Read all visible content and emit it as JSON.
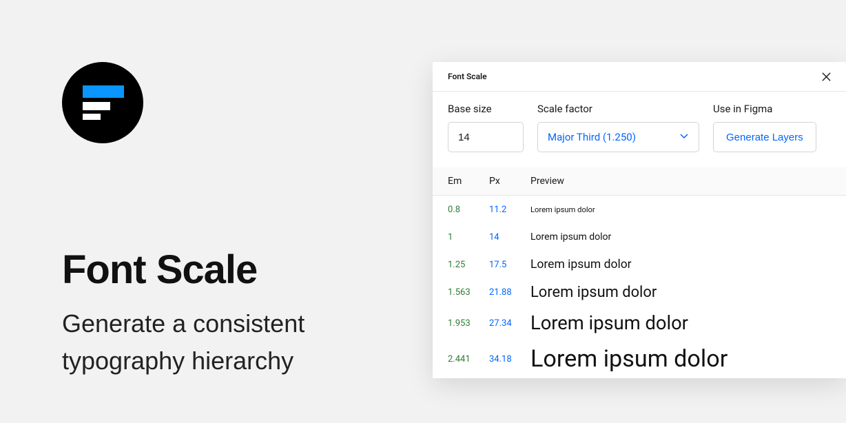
{
  "hero": {
    "title": "Font Scale",
    "subtitle": "Generate a consistent typography hierarchy"
  },
  "plugin": {
    "title": "Font Scale",
    "controls": {
      "base_label": "Base size",
      "base_value": "14",
      "scale_label": "Scale factor",
      "scale_value": "Major Third (1.250)",
      "figma_label": "Use in Figma",
      "generate_label": "Generate Layers"
    },
    "table": {
      "headers": {
        "em": "Em",
        "px": "Px",
        "preview": "Preview"
      },
      "rows": [
        {
          "em": "0.8",
          "px": "11.2",
          "preview": "Lorem ipsum dolor",
          "size": 11.2
        },
        {
          "em": "1",
          "px": "14",
          "preview": "Lorem ipsum dolor",
          "size": 14
        },
        {
          "em": "1.25",
          "px": "17.5",
          "preview": "Lorem ipsum dolor",
          "size": 17.5
        },
        {
          "em": "1.563",
          "px": "21.88",
          "preview": "Lorem ipsum dolor",
          "size": 21.88
        },
        {
          "em": "1.953",
          "px": "27.34",
          "preview": "Lorem ipsum dolor",
          "size": 27.34
        },
        {
          "em": "2.441",
          "px": "34.18",
          "preview": "Lorem ipsum dolor",
          "size": 34.18
        }
      ]
    }
  }
}
